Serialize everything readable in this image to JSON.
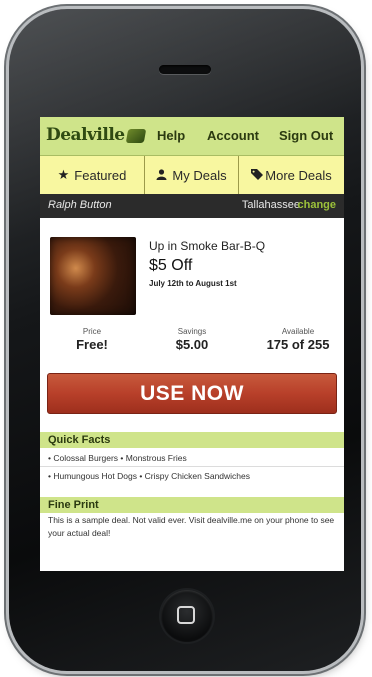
{
  "header": {
    "logo_text": "Dealville",
    "nav": [
      "Help",
      "Account",
      "Sign Out"
    ]
  },
  "tabs": [
    {
      "label": "Featured",
      "icon": "star-icon"
    },
    {
      "label": "My Deals",
      "icon": "person-icon"
    },
    {
      "label": "More Deals",
      "icon": "tag-icon"
    }
  ],
  "userbar": {
    "name": "Ralph Button",
    "city": "Tallahassee",
    "change": "change"
  },
  "deal": {
    "title": "Up in Smoke Bar-B-Q",
    "offer": "$5 Off",
    "dates": "July 12th to August 1st",
    "stats": [
      {
        "label": "Price",
        "value": "Free!"
      },
      {
        "label": "Savings",
        "value": "$5.00"
      },
      {
        "label": "Available",
        "value": "175 of 255"
      }
    ],
    "button": "USE NOW"
  },
  "quick_facts": {
    "title": "Quick Facts",
    "items": [
      "• Colossal Burgers • Monstrous Fries",
      "• Humungous Hot Dogs • Crispy Chicken Sandwiches"
    ]
  },
  "fine_print": {
    "title": "Fine Print",
    "text": "This is a sample deal. Not valid ever. Visit dealville.me on your phone to see your actual deal!"
  },
  "colors": {
    "accent_green": "#cfe48a",
    "tab_yellow": "#f8f7a0",
    "button_red": "#b8402a",
    "link_green": "#9cc23a"
  }
}
